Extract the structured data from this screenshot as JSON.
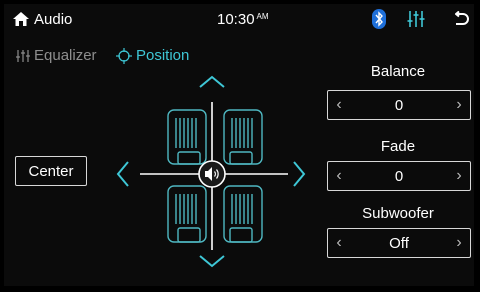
{
  "status_bar": {
    "home_icon": "home-icon",
    "app_title": "Audio",
    "time": "10:30",
    "time_suffix": "AM",
    "bluetooth_icon": "bluetooth-icon",
    "equalizer_icon": "equalizer-sliders-icon",
    "back_icon": "back-arrow-icon"
  },
  "tabs": [
    {
      "label": "Equalizer",
      "icon": "equalizer-sliders-icon",
      "active": false
    },
    {
      "label": "Position",
      "icon": "position-target-icon",
      "active": true
    }
  ],
  "position_pad": {
    "center_label": "Center",
    "speaker_icon": "speaker-icon",
    "seats": [
      "front-left",
      "front-right",
      "rear-left",
      "rear-right"
    ]
  },
  "controls": {
    "balance": {
      "label": "Balance",
      "value": "0"
    },
    "fade": {
      "label": "Fade",
      "value": "0"
    },
    "subwoofer": {
      "label": "Subwoofer",
      "value": "Off"
    }
  },
  "colors": {
    "accent": "#3ec7d6",
    "bluetooth": "#1e6fd9",
    "seat": "#4fb8c2",
    "background": "#0b0b0b"
  }
}
